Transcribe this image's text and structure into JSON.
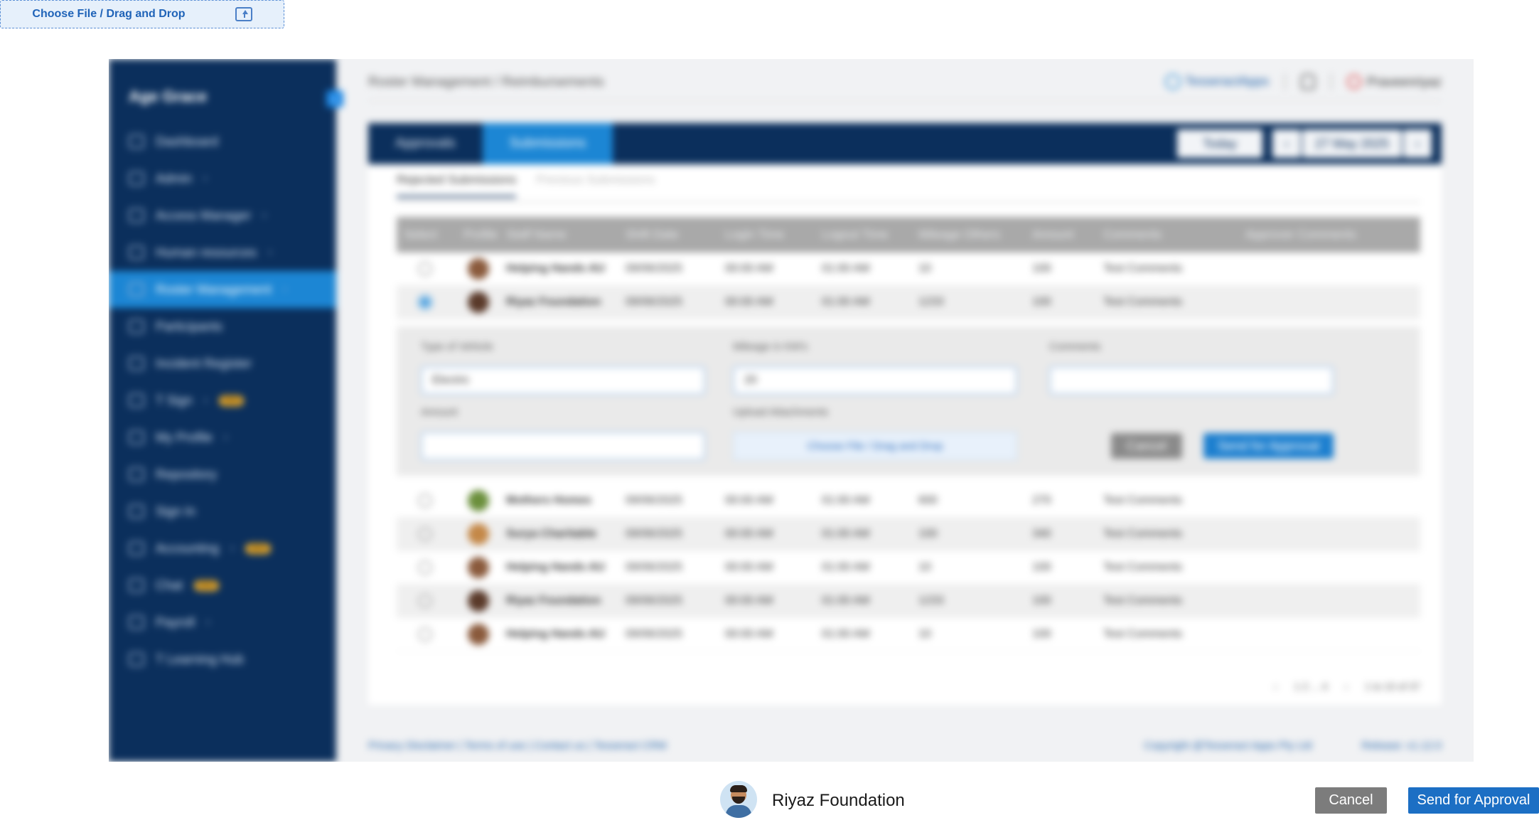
{
  "top_upload": {
    "label": "Choose File  / Drag and Drop",
    "icon": "upload-icon"
  },
  "app": {
    "brand": "Age Grace",
    "collapse_label": "«",
    "nav": [
      {
        "label": "Dashboard",
        "chev": "",
        "badge": ""
      },
      {
        "label": "Admin",
        "chev": "›",
        "badge": ""
      },
      {
        "label": "Access Manager",
        "chev": "›",
        "badge": ""
      },
      {
        "label": "Human resources",
        "chev": "›",
        "badge": ""
      },
      {
        "label": "Roster Management",
        "chev": "›",
        "badge": ""
      },
      {
        "label": "Participants",
        "chev": "",
        "badge": ""
      },
      {
        "label": "Incident Register",
        "chev": "",
        "badge": ""
      },
      {
        "label": "T Sign",
        "chev": "›",
        "badge": "NEW"
      },
      {
        "label": "My Profile",
        "chev": "›",
        "badge": ""
      },
      {
        "label": "Repository",
        "chev": "",
        "badge": ""
      },
      {
        "label": "Sign In",
        "chev": "",
        "badge": ""
      },
      {
        "label": "Accounting",
        "chev": "›",
        "badge": "NEW"
      },
      {
        "label": "Chat",
        "chev": "",
        "badge": "NEW"
      },
      {
        "label": "Payroll",
        "chev": "›",
        "badge": ""
      },
      {
        "label": "T Learning Hub",
        "chev": "",
        "badge": ""
      }
    ],
    "breadcrumb": "Roster Management / Reimbursements",
    "header": {
      "brand_link": "TesseractApps",
      "user": "Praveenriyaz"
    },
    "tabs": [
      "Approvals",
      "Submissions"
    ],
    "date_controls": {
      "today": "Today",
      "prev": "‹",
      "date": "27 May 2025",
      "next": "›"
    },
    "subtabs": [
      "Rejected Submissions",
      "Previous Submissions"
    ],
    "columns": [
      "Select",
      "Profile",
      "Staff Name",
      "Shift Date",
      "Login Time",
      "Logout Time",
      "Mileage Others",
      "Amount",
      "Comments",
      "Approver Comments"
    ],
    "rows_top": [
      {
        "name": "Helping Hands AU",
        "date": "09/06/2025",
        "login": "00:00 AM",
        "logout": "01:00 AM",
        "mileage": "10",
        "amount": "100",
        "comments": "Test Comments"
      },
      {
        "name": "Riyaz Foundation",
        "date": "09/06/2025",
        "login": "00:00 AM",
        "logout": "01:00 AM",
        "mileage": "1233",
        "amount": "100",
        "comments": "Test Comments"
      }
    ],
    "expand": {
      "vehicle_label": "Type of Vehicle",
      "vehicle_value": "Electric",
      "mileage_label": "Mileage in KM's",
      "mileage_value": "20",
      "comments_label": "Comments",
      "amount_label": "Amount",
      "upload_label": "Upload Attachments",
      "upload_text": "Choose File  / Drag and Drop",
      "cancel": "Cancel",
      "send": "Send for Approval"
    },
    "rows_bottom": [
      {
        "name": "Mothers Homes",
        "date": "09/06/2025",
        "login": "00:00 AM",
        "logout": "01:00 AM",
        "mileage": "600",
        "amount": "270",
        "comments": "Test Comments"
      },
      {
        "name": "Surya Charitable",
        "date": "09/06/2025",
        "login": "00:00 AM",
        "logout": "01:00 AM",
        "mileage": "100",
        "amount": "340",
        "comments": "Test Comments"
      },
      {
        "name": "Helping Hands AU",
        "date": "09/06/2025",
        "login": "00:00 AM",
        "logout": "01:00 AM",
        "mileage": "10",
        "amount": "100",
        "comments": "Test Comments"
      },
      {
        "name": "Riyaz Foundation",
        "date": "09/06/2025",
        "login": "00:00 AM",
        "logout": "01:00 AM",
        "mileage": "1233",
        "amount": "100",
        "comments": "Test Comments"
      },
      {
        "name": "Helping Hands AU",
        "date": "09/06/2025",
        "login": "00:00 AM",
        "logout": "01:00 AM",
        "mileage": "10",
        "amount": "100",
        "comments": "Test Comments"
      }
    ],
    "pager": {
      "prev": "‹",
      "pages": "1  2  ...  4",
      "next": "›",
      "summary": "1 to 10 of 37"
    },
    "footer": {
      "links": "Privacy Disclaimer | Terms of use | Contact us  | Tesseract CRM",
      "copyright": "Copyright @Tesseract Apps Pty Ltd",
      "release": "Release: v1.12.0"
    }
  },
  "bottom_bar": {
    "name": "Riyaz Foundation",
    "cancel": "Cancel",
    "send": "Send for Approval"
  },
  "colors": {
    "sidebar": "#0b2f5c",
    "accent": "#1c86d4",
    "send": "#1c6fc4",
    "cancel": "#7c7c7c"
  }
}
